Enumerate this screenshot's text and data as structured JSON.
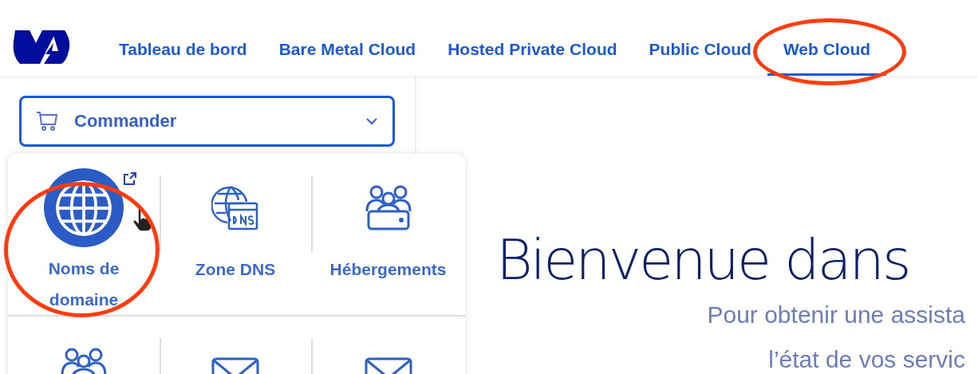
{
  "nav": [
    {
      "label": "Tableau de bord",
      "selected": false,
      "circled": false
    },
    {
      "label": "Bare Metal Cloud",
      "selected": false,
      "circled": false
    },
    {
      "label": "Hosted Private Cloud",
      "selected": false,
      "circled": false
    },
    {
      "label": "Public Cloud",
      "selected": false,
      "circled": false
    },
    {
      "label": "Web Cloud",
      "selected": true,
      "circled": true
    }
  ],
  "order_button": {
    "label": "Commander"
  },
  "products": [
    {
      "kind": "globe",
      "label": "Noms de domaine",
      "selected": true,
      "external": true,
      "circled": true
    },
    {
      "kind": "dns",
      "label": "Zone DNS",
      "selected": false,
      "external": false,
      "circled": false
    },
    {
      "kind": "hosting",
      "label": "Hébergements",
      "selected": false,
      "external": false,
      "circled": false
    },
    {
      "kind": "group",
      "selected": false,
      "external": false,
      "circled": false
    },
    {
      "kind": "mail",
      "selected": false,
      "external": false,
      "circled": false
    },
    {
      "kind": "mail",
      "selected": false,
      "external": false,
      "circled": false
    }
  ],
  "welcome": {
    "title": "Bienvenue dans",
    "lines": [
      "Pour obtenir une assista",
      "l’état de vos servic"
    ]
  }
}
